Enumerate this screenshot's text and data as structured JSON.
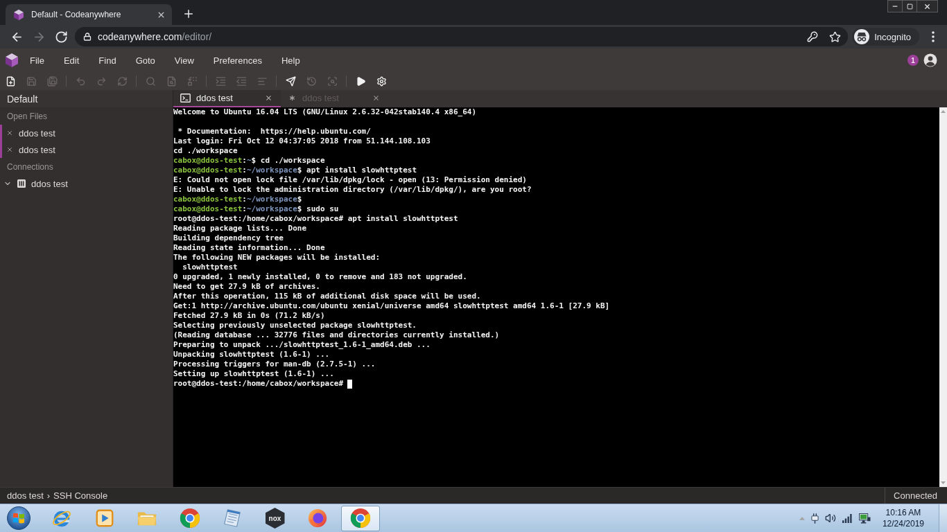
{
  "browser": {
    "tabs": [
      {
        "title": "Default - Codeanywhere",
        "selected": true
      }
    ],
    "nav": [
      {
        "kind": "back",
        "disabled": false
      },
      {
        "kind": "forward",
        "disabled": true
      },
      {
        "kind": "reload",
        "disabled": false
      }
    ],
    "address": {
      "host": "codeanywhere.com",
      "path": "/editor/"
    },
    "profile": {
      "label": "Incognito"
    }
  },
  "app": {
    "menu": [
      "File",
      "Edit",
      "Find",
      "Goto",
      "View",
      "Preferences",
      "Help"
    ],
    "notifications": {
      "count": "1"
    },
    "toolbar": [
      [
        {
          "kind": "newfile",
          "disabled": false
        },
        {
          "kind": "save",
          "disabled": true
        },
        {
          "kind": "saveall",
          "disabled": true
        }
      ],
      [
        {
          "kind": "undo",
          "disabled": true
        },
        {
          "kind": "redo",
          "disabled": true
        },
        {
          "kind": "reload",
          "disabled": true
        }
      ],
      [
        {
          "kind": "find",
          "disabled": true
        },
        {
          "kind": "findfile",
          "disabled": true
        },
        {
          "kind": "replace",
          "disabled": true
        }
      ],
      [
        {
          "kind": "indent",
          "disabled": true
        },
        {
          "kind": "outdent",
          "disabled": true
        },
        {
          "kind": "format",
          "disabled": true
        }
      ],
      [
        {
          "kind": "deploy",
          "disabled": false
        },
        {
          "kind": "history",
          "disabled": true
        },
        {
          "kind": "preview",
          "disabled": true
        }
      ],
      [
        {
          "kind": "run",
          "disabled": false
        },
        {
          "kind": "settings",
          "disabled": false
        }
      ]
    ]
  },
  "sidebar": {
    "title": "Default",
    "sections": [
      {
        "kind": "files",
        "title": "Open Files",
        "items": [
          {
            "label": "ddos test"
          },
          {
            "label": "ddos test"
          }
        ]
      },
      {
        "kind": "connections",
        "title": "Connections",
        "items": [
          {
            "label": "ddos test",
            "expanded": true
          }
        ]
      }
    ]
  },
  "editor": {
    "tabs": [
      {
        "kind": "terminal",
        "label": "ddos test",
        "selected": true
      },
      {
        "kind": "pending",
        "label": "ddos test",
        "selected": false
      }
    ],
    "terminal": {
      "cursor": true,
      "lines": [
        {
          "kind": "output",
          "text": "Welcome to Ubuntu 16.04 LTS (GNU/Linux 2.6.32-042stab140.4 x86_64)"
        },
        {
          "kind": "blank"
        },
        {
          "kind": "output",
          "text": " * Documentation:  https://help.ubuntu.com/"
        },
        {
          "kind": "output",
          "text": "Last login: Fri Oct 12 04:37:05 2018 from 51.144.108.103"
        },
        {
          "kind": "output",
          "text": "cd ./workspace"
        },
        {
          "kind": "prompt",
          "segments": [
            {
              "kind": "user",
              "text": "cabox@ddos-test"
            },
            {
              "kind": "plain",
              "text": ":"
            },
            {
              "kind": "path",
              "text": "~"
            },
            {
              "kind": "plain",
              "text": "$ cd ./workspace"
            }
          ]
        },
        {
          "kind": "prompt",
          "segments": [
            {
              "kind": "user",
              "text": "cabox@ddos-test"
            },
            {
              "kind": "plain",
              "text": ":"
            },
            {
              "kind": "path",
              "text": "~/workspace"
            },
            {
              "kind": "plain",
              "text": "$ apt install slowhttptest"
            }
          ]
        },
        {
          "kind": "output",
          "text": "E: Could not open lock file /var/lib/dpkg/lock - open (13: Permission denied)"
        },
        {
          "kind": "output",
          "text": "E: Unable to lock the administration directory (/var/lib/dpkg/), are you root?"
        },
        {
          "kind": "prompt",
          "segments": [
            {
              "kind": "user",
              "text": "cabox@ddos-test"
            },
            {
              "kind": "plain",
              "text": ":"
            },
            {
              "kind": "path",
              "text": "~/workspace"
            },
            {
              "kind": "plain",
              "text": "$"
            }
          ]
        },
        {
          "kind": "prompt",
          "segments": [
            {
              "kind": "user",
              "text": "cabox@ddos-test"
            },
            {
              "kind": "plain",
              "text": ":"
            },
            {
              "kind": "path",
              "text": "~/workspace"
            },
            {
              "kind": "plain",
              "text": "$ sudo su"
            }
          ]
        },
        {
          "kind": "output",
          "text": "root@ddos-test:/home/cabox/workspace# apt install slowhttptest"
        },
        {
          "kind": "output",
          "text": "Reading package lists... Done"
        },
        {
          "kind": "output",
          "text": "Building dependency tree"
        },
        {
          "kind": "output",
          "text": "Reading state information... Done"
        },
        {
          "kind": "output",
          "text": "The following NEW packages will be installed:"
        },
        {
          "kind": "output",
          "text": "  slowhttptest"
        },
        {
          "kind": "output",
          "text": "0 upgraded, 1 newly installed, 0 to remove and 183 not upgraded."
        },
        {
          "kind": "output",
          "text": "Need to get 27.9 kB of archives."
        },
        {
          "kind": "output",
          "text": "After this operation, 115 kB of additional disk space will be used."
        },
        {
          "kind": "output",
          "text": "Get:1 http://archive.ubuntu.com/ubuntu xenial/universe amd64 slowhttptest amd64 1.6-1 [27.9 kB]"
        },
        {
          "kind": "output",
          "text": "Fetched 27.9 kB in 0s (71.2 kB/s)"
        },
        {
          "kind": "output",
          "text": "Selecting previously unselected package slowhttptest."
        },
        {
          "kind": "output",
          "text": "(Reading database ... 32776 files and directories currently installed.)"
        },
        {
          "kind": "output",
          "text": "Preparing to unpack .../slowhttptest_1.6-1_amd64.deb ..."
        },
        {
          "kind": "output",
          "text": "Unpacking slowhttptest (1.6-1) ..."
        },
        {
          "kind": "output",
          "text": "Processing triggers for man-db (2.7.5-1) ..."
        },
        {
          "kind": "output",
          "text": "Setting up slowhttptest (1.6-1) ..."
        },
        {
          "kind": "output",
          "text": "root@ddos-test:/home/cabox/workspace#"
        }
      ]
    }
  },
  "status_bar": {
    "breadcrumb": [
      "ddos test",
      "SSH Console"
    ],
    "separator": "›",
    "status": "Connected"
  },
  "taskbar": {
    "apps": [
      {
        "kind": "ie",
        "active": false
      },
      {
        "kind": "media",
        "active": false
      },
      {
        "kind": "explorer",
        "active": false
      },
      {
        "kind": "chrome",
        "active": false
      },
      {
        "kind": "notes",
        "active": false
      },
      {
        "kind": "nox",
        "label": "nox",
        "active": false
      },
      {
        "kind": "firefox",
        "active": false
      },
      {
        "kind": "chrome",
        "active": true
      }
    ],
    "clock": {
      "time": "10:16 AM",
      "date": "12/24/2019"
    }
  }
}
